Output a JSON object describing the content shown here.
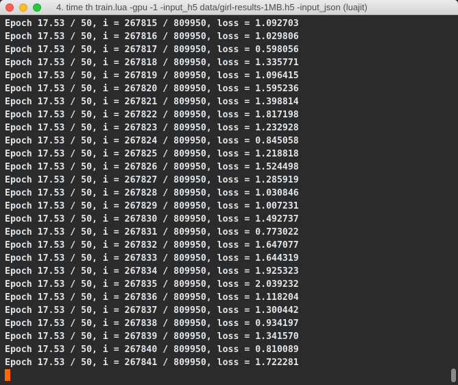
{
  "window": {
    "title": "4. time th train.lua -gpu -1 -input_h5 data/girl-results-1MB.h5 -input_json      (luajit)"
  },
  "terminal": {
    "lines": [
      "Epoch 17.53 / 50, i = 267815 / 809950, loss = 1.092703",
      "Epoch 17.53 / 50, i = 267816 / 809950, loss = 1.029806",
      "Epoch 17.53 / 50, i = 267817 / 809950, loss = 0.598056",
      "Epoch 17.53 / 50, i = 267818 / 809950, loss = 1.335771",
      "Epoch 17.53 / 50, i = 267819 / 809950, loss = 1.096415",
      "Epoch 17.53 / 50, i = 267820 / 809950, loss = 1.595236",
      "Epoch 17.53 / 50, i = 267821 / 809950, loss = 1.398814",
      "Epoch 17.53 / 50, i = 267822 / 809950, loss = 1.817198",
      "Epoch 17.53 / 50, i = 267823 / 809950, loss = 1.232928",
      "Epoch 17.53 / 50, i = 267824 / 809950, loss = 0.845058",
      "Epoch 17.53 / 50, i = 267825 / 809950, loss = 1.218818",
      "Epoch 17.53 / 50, i = 267826 / 809950, loss = 1.524498",
      "Epoch 17.53 / 50, i = 267827 / 809950, loss = 1.285919",
      "Epoch 17.53 / 50, i = 267828 / 809950, loss = 1.030846",
      "Epoch 17.53 / 50, i = 267829 / 809950, loss = 1.007231",
      "Epoch 17.53 / 50, i = 267830 / 809950, loss = 1.492737",
      "Epoch 17.53 / 50, i = 267831 / 809950, loss = 0.773022",
      "Epoch 17.53 / 50, i = 267832 / 809950, loss = 1.647077",
      "Epoch 17.53 / 50, i = 267833 / 809950, loss = 1.644319",
      "Epoch 17.53 / 50, i = 267834 / 809950, loss = 1.925323",
      "Epoch 17.53 / 50, i = 267835 / 809950, loss = 2.039232",
      "Epoch 17.53 / 50, i = 267836 / 809950, loss = 1.118204",
      "Epoch 17.53 / 50, i = 267837 / 809950, loss = 1.300442",
      "Epoch 17.53 / 50, i = 267838 / 809950, loss = 0.934197",
      "Epoch 17.53 / 50, i = 267839 / 809950, loss = 1.341570",
      "Epoch 17.53 / 50, i = 267840 / 809950, loss = 0.810089",
      "Epoch 17.53 / 50, i = 267841 / 809950, loss = 1.722281"
    ]
  },
  "colors": {
    "background": "#2b2b2b",
    "text": "#dfe6ec",
    "cursor": "#ff6a00"
  }
}
